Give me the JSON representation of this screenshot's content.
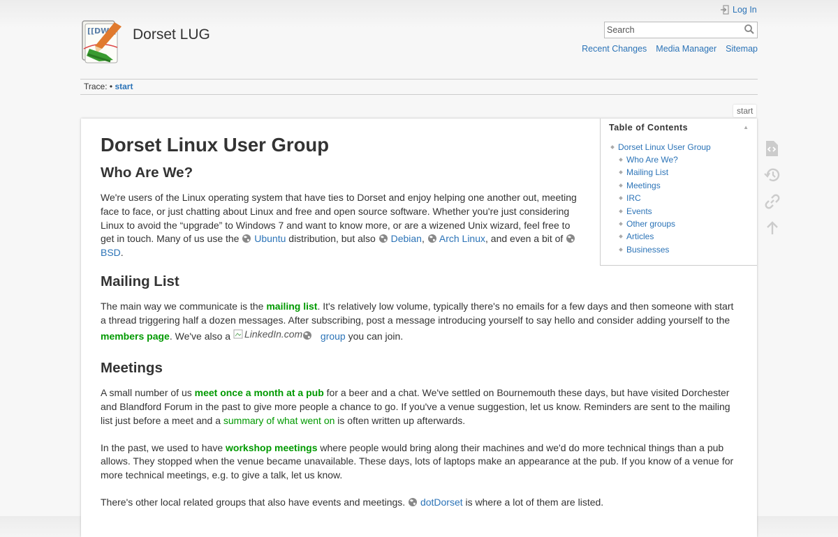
{
  "site": {
    "title": "Dorset LUG",
    "logo_icon": "dokuwiki-logo",
    "logo_text": "[[DW]]"
  },
  "user_tools": {
    "login_label": "Log In"
  },
  "search": {
    "placeholder": "Search"
  },
  "site_tools": {
    "recent_changes": "Recent Changes",
    "media_manager": "Media Manager",
    "sitemap": "Sitemap"
  },
  "breadcrumb": {
    "label": "Trace:",
    "separator": "•",
    "current": "start"
  },
  "page_id": "start",
  "toc": {
    "title": "Table of Contents",
    "toggle": "▲",
    "items": [
      {
        "label": "Dorset Linux User Group"
      },
      {
        "label": "Who Are We?"
      },
      {
        "label": "Mailing List"
      },
      {
        "label": "Meetings"
      },
      {
        "label": "IRC"
      },
      {
        "label": "Events"
      },
      {
        "label": "Other groups"
      },
      {
        "label": "Articles"
      },
      {
        "label": "Businesses"
      }
    ]
  },
  "content": {
    "h1": "Dorset Linux User Group",
    "who": {
      "heading": "Who Are We?",
      "text1": "We're users of the Linux operating system that have ties to Dorset and enjoy helping one another out, meeting face to face, or just chatting about Linux and free and open source software. Whether you're just considering Linux to avoid the “upgrade” to Windows 7 and want to know more, or are a wizened Unix wizard, feel free to get in touch. Many of us use the ",
      "ubuntu": "Ubuntu",
      "text2": " distribution, but also ",
      "debian": "Debian",
      "comma": ",",
      "arch": "Arch Linux",
      "text3": ", and even a bit of ",
      "bsd": "BSD",
      "period": "."
    },
    "mailing": {
      "heading": "Mailing List",
      "text1": "The main way we communicate is the ",
      "mailing_link": "mailing list",
      "text2": ". It's relatively low volume, typically there's no emails for a few days and then someone with start a thread triggering half a dozen messages. After subscribing, post a message introducing yourself to say hello and consider adding yourself to the ",
      "members_link": "members page",
      "text3": ". We've also a ",
      "linkedin_alt": "LinkedIn.com",
      "group_link": "group",
      "text4": " you can join."
    },
    "meetings": {
      "heading": "Meetings",
      "p1_text1": "A small number of us ",
      "p1_link1": "meet once a month at a pub",
      "p1_text2": " for a beer and a chat. We've settled on Bournemouth these days, but have visited Dorchester and Blandford Forum in the past to give more people a chance to go. If you've a venue suggestion, let us know. Reminders are sent to the mailing list just before a meet and a ",
      "p1_link2": "summary of what went on",
      "p1_text3": " is often written up afterwards.",
      "p2_text1": "In the past, we used to have ",
      "p2_link": "workshop meetings",
      "p2_text2": " where people would bring along their machines and we'd do more technical things than a pub allows. They stopped when the venue became unavailable. These days, lots of laptops make an appearance at the pub. If you know of a venue for more technical meetings, e.g. to give a talk, let us know.",
      "p3_text1": "There's other local related groups that also have events and meetings. ",
      "p3_link": "dotDorset",
      "p3_text2": " is where a lot of them are listed."
    }
  },
  "page_tools": [
    "show-source-icon",
    "old-revisions-icon",
    "backlinks-icon",
    "back-to-top-icon"
  ]
}
